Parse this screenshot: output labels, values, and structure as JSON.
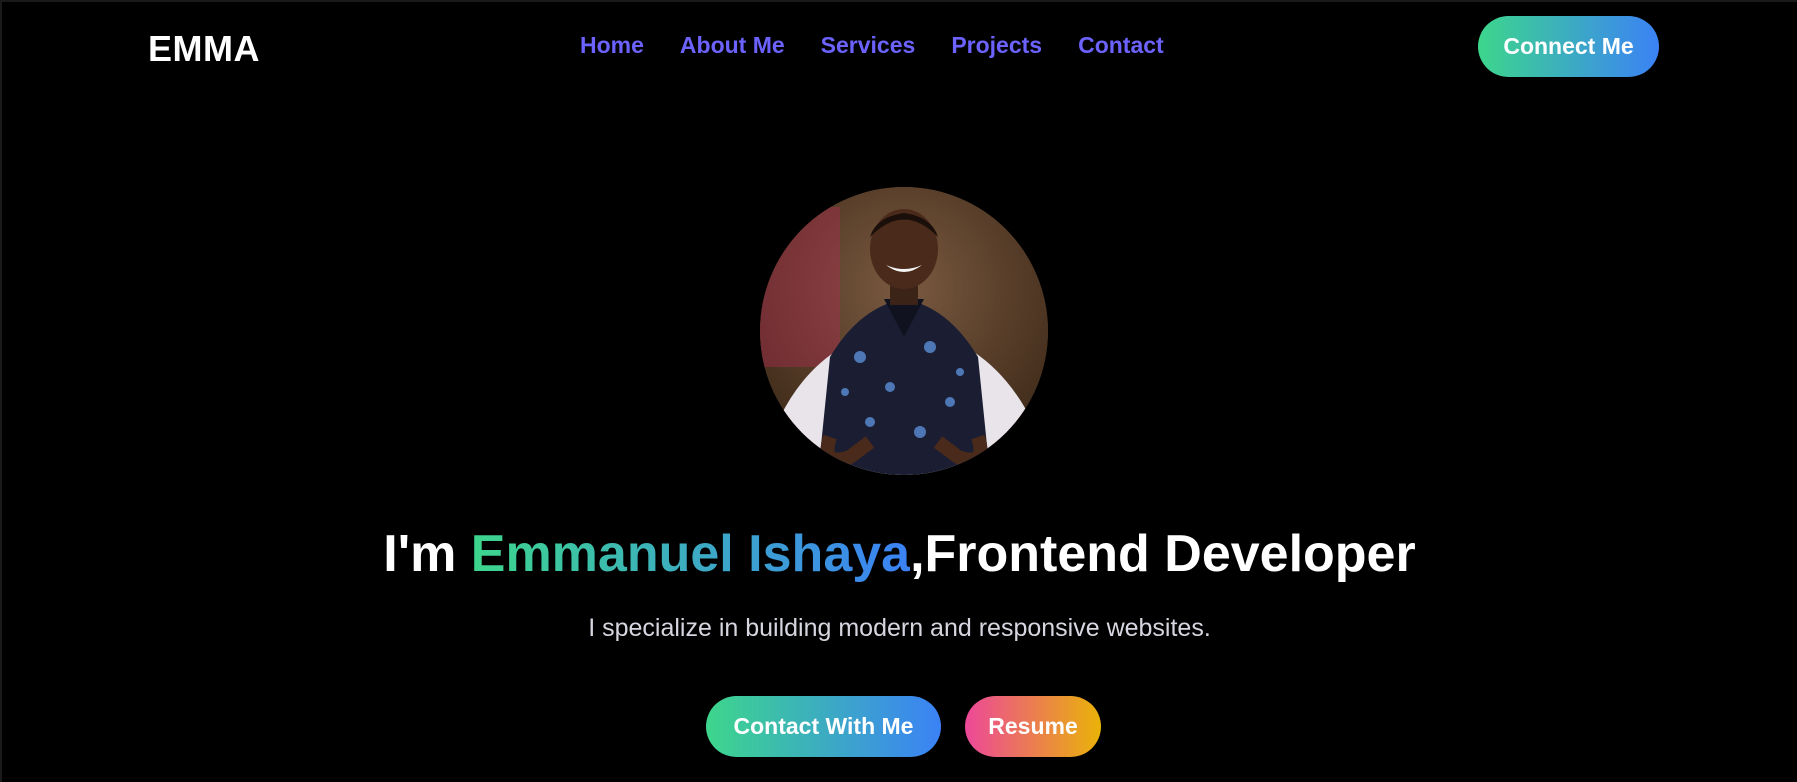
{
  "brand": {
    "logo": "EMMA"
  },
  "nav": {
    "links": [
      "Home",
      "About Me",
      "Services",
      "Projects",
      "Contact"
    ],
    "cta": "Connect Me",
    "link_color": "#6c63ff"
  },
  "hero": {
    "avatar_icon": "profile-photo",
    "headline_prefix": "I'm ",
    "headline_name": "Emmanuel Ishaya",
    "headline_suffix": ",Frontend Developer",
    "subtitle": "I specialize in building modern and responsive websites.",
    "buttons": {
      "contact": "Contact With Me",
      "resume": "Resume"
    }
  },
  "colors": {
    "background": "#000000",
    "gradient_green_blue": [
      "#3dd68c",
      "#3b82f6"
    ],
    "gradient_pink_yellow": [
      "#ec4899",
      "#eab308"
    ]
  }
}
